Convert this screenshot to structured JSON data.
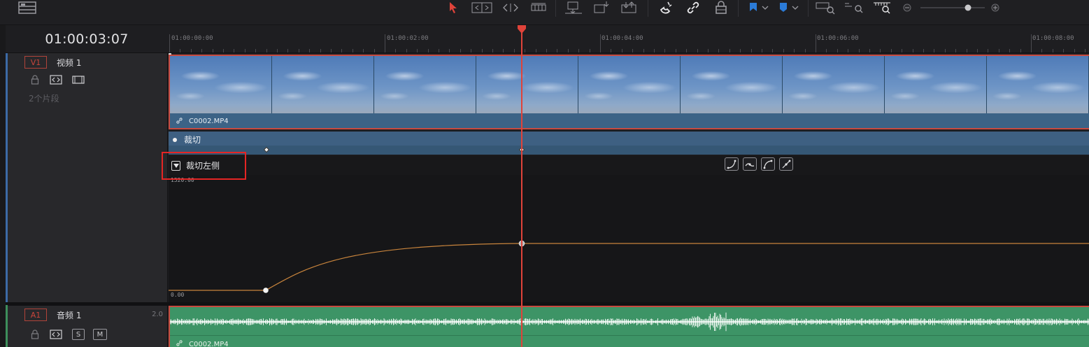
{
  "timecode": "01:00:03:07",
  "ruler": {
    "labels": [
      "01:00:00:00",
      "01:00:02:00",
      "01:00:04:00",
      "01:00:06:00",
      "01:00:08:00"
    ]
  },
  "video_track": {
    "id": "V1",
    "name": "视频 1",
    "clip_count": "2个片段",
    "clip_name": "C0002.MP4"
  },
  "keyframe_track": {
    "title": "裁切",
    "curve_title": "裁切左侧",
    "max_value": "1520.00",
    "min_value": "0.00"
  },
  "audio_track": {
    "id": "A1",
    "name": "音频 1",
    "channels": "2.0",
    "solo_label": "S",
    "mute_label": "M",
    "clip_name": "C0002.MP4"
  },
  "colors": {
    "playhead": "#e0433a",
    "video_clip": "#3e6788",
    "audio_clip": "#3d9466",
    "curve": "#c8843c",
    "highlight": "#e52524"
  }
}
